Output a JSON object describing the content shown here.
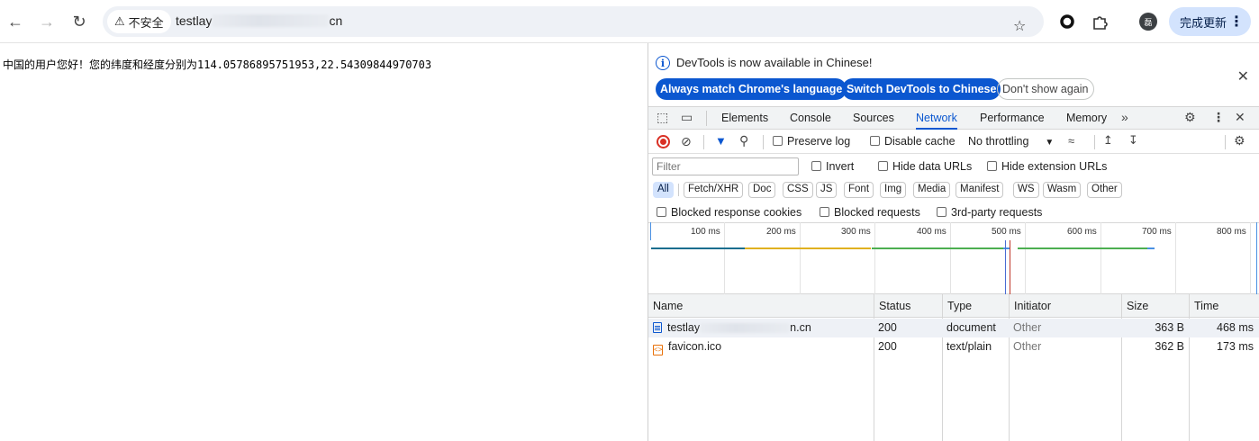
{
  "browser": {
    "security_label": "不安全",
    "url_prefix": "testlay",
    "url_suffix": "cn",
    "update_label": "完成更新",
    "avatar_letter": "磊"
  },
  "page": {
    "text": "中国的用户您好！您的纬度和经度分别为114.05786895751953,22.54309844970703"
  },
  "devtools": {
    "infobar": {
      "message": "DevTools is now available in Chinese!",
      "btn_match": "Always match Chrome's language",
      "btn_switch": "Switch DevTools to Chinese",
      "btn_dont": "Don't show again"
    },
    "tabs": [
      "Elements",
      "Console",
      "Sources",
      "Network",
      "Performance",
      "Memory"
    ],
    "toolbar": {
      "preserve_log": "Preserve log",
      "disable_cache": "Disable cache",
      "throttling": "No throttling"
    },
    "filter": {
      "placeholder": "Filter",
      "invert": "Invert",
      "hide_data": "Hide data URLs",
      "hide_ext": "Hide extension URLs"
    },
    "types": [
      "All",
      "Fetch/XHR",
      "Doc",
      "CSS",
      "JS",
      "Font",
      "Img",
      "Media",
      "Manifest",
      "WS",
      "Wasm",
      "Other"
    ],
    "blocked": {
      "cookies": "Blocked response cookies",
      "requests": "Blocked requests",
      "third_party": "3rd-party requests"
    },
    "timeline_ticks": [
      "100 ms",
      "200 ms",
      "300 ms",
      "400 ms",
      "500 ms",
      "600 ms",
      "700 ms",
      "800 ms"
    ],
    "table": {
      "headers": [
        "Name",
        "Status",
        "Type",
        "Initiator",
        "Size",
        "Time"
      ],
      "rows": [
        {
          "name_a": "testlay",
          "name_b": "n.cn",
          "status": "200",
          "type": "document",
          "initiator": "Other",
          "size": "363 B",
          "time": "468 ms"
        },
        {
          "name_a": "favicon.ico",
          "name_b": "",
          "status": "200",
          "type": "text/plain",
          "initiator": "Other",
          "size": "362 B",
          "time": "173 ms"
        }
      ]
    }
  }
}
